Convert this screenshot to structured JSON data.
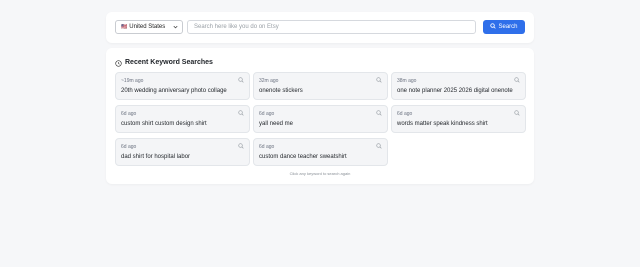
{
  "search": {
    "country": "United States",
    "placeholder": "Search here like you do on Etsy",
    "button_label": "Search"
  },
  "recent": {
    "title": "Recent Keyword Searches",
    "hint": "Click any keyword to search again",
    "items": [
      {
        "time": "~19m ago",
        "keyword": "20th wedding anniversary photo collage"
      },
      {
        "time": "32m ago",
        "keyword": "onenote stickers"
      },
      {
        "time": "38m ago",
        "keyword": "one note planner 2025 2026 digital onenote"
      },
      {
        "time": "6d ago",
        "keyword": "custom shirt custom design shirt"
      },
      {
        "time": "6d ago",
        "keyword": "yall need me"
      },
      {
        "time": "6d ago",
        "keyword": "words matter speak kindness shirt"
      },
      {
        "time": "6d ago",
        "keyword": "dad shirt for hospital labor"
      },
      {
        "time": "6d ago",
        "keyword": "custom dance teacher sweatshirt"
      }
    ]
  },
  "colors": {
    "accent": "#2f6fea",
    "background": "#f6f7f9",
    "card": "#f4f5f7"
  }
}
